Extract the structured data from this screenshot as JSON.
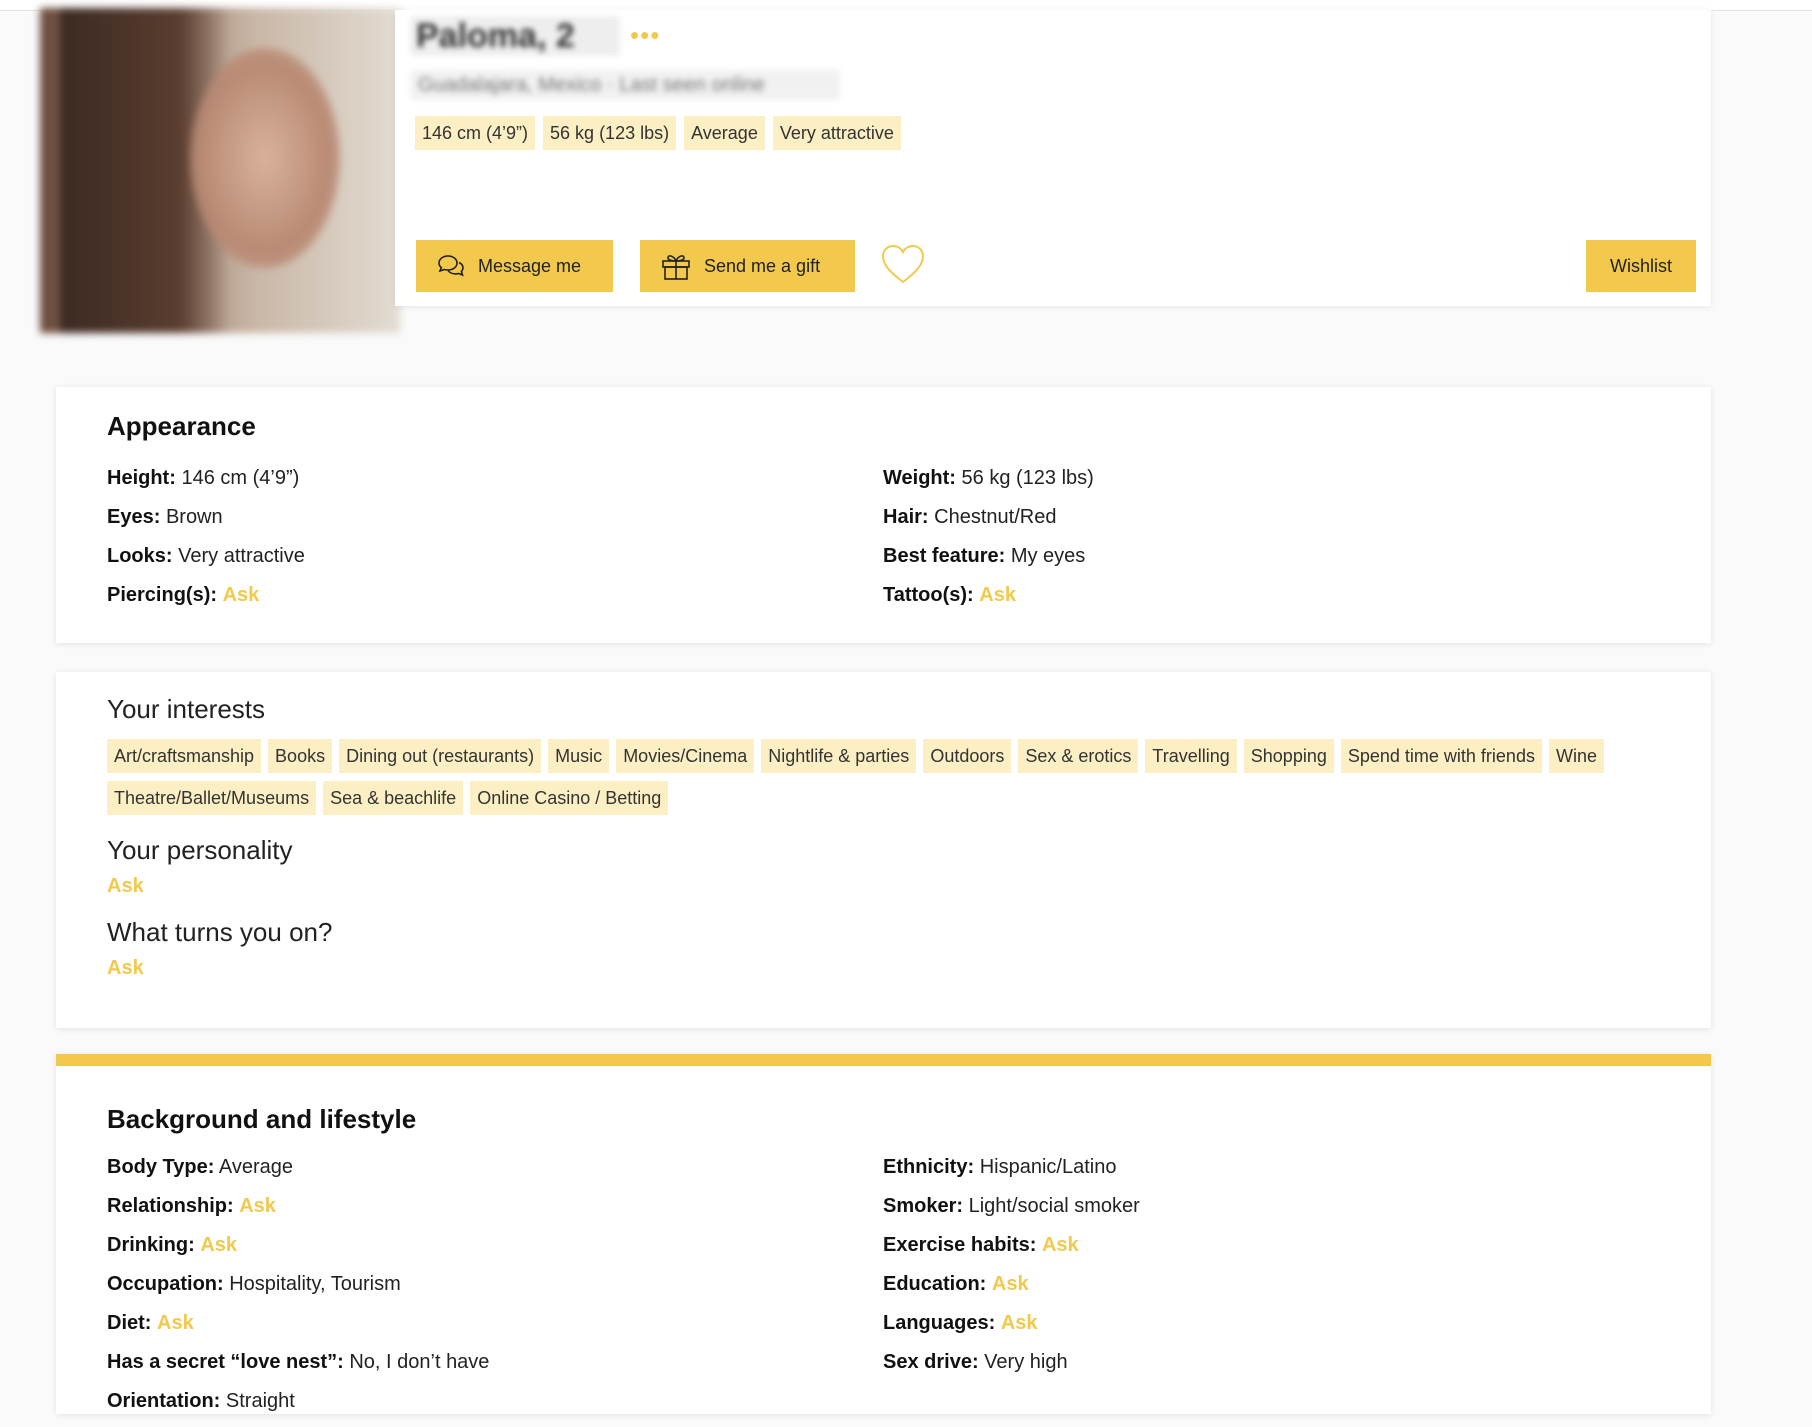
{
  "profile": {
    "name": "Paloma, 2",
    "subtitle": "Guadalajara, Mexico · Last seen online",
    "more_glyph": "•••",
    "chips": [
      "146 cm (4’9”)",
      "56 kg (123 lbs)",
      "Average",
      "Very attractive"
    ],
    "actions": {
      "message": "Message me",
      "gift": "Send me a gift",
      "wishlist": "Wishlist"
    }
  },
  "appearance": {
    "title": "Appearance",
    "rows": [
      {
        "label": "Height:",
        "value": "146 cm (4’9”)"
      },
      {
        "label": "Weight:",
        "value": "56 kg (123 lbs)"
      },
      {
        "label": "Eyes:",
        "value": "Brown"
      },
      {
        "label": "Hair:",
        "value": "Chestnut/Red"
      },
      {
        "label": "Looks:",
        "value": "Very attractive"
      },
      {
        "label": "Best feature:",
        "value": "My eyes"
      },
      {
        "label": "Piercing(s):",
        "value": "Ask",
        "ask": true
      },
      {
        "label": "Tattoo(s):",
        "value": "Ask",
        "ask": true
      }
    ]
  },
  "interests": {
    "title": "Your interests",
    "tags": [
      "Art/craftsmanship",
      "Books",
      "Dining out (restaurants)",
      "Music",
      "Movies/Cinema",
      "Nightlife & parties",
      "Outdoors",
      "Sex & erotics",
      "Travelling",
      "Shopping",
      "Spend time with friends",
      "Wine",
      "Theatre/Ballet/Museums",
      "Sea & beachlife",
      "Online Casino / Betting"
    ],
    "personality_title": "Your personality",
    "personality_value": "Ask",
    "turnon_title": "What turns you on?",
    "turnon_value": "Ask"
  },
  "background": {
    "title": "Background and lifestyle",
    "rows": [
      {
        "label": "Body Type:",
        "value": "Average"
      },
      {
        "label": "Ethnicity:",
        "value": "Hispanic/Latino"
      },
      {
        "label": "Relationship:",
        "value": "Ask",
        "ask": true
      },
      {
        "label": "Smoker:",
        "value": "Light/social smoker"
      },
      {
        "label": "Drinking:",
        "value": "Ask",
        "ask": true
      },
      {
        "label": "Exercise habits:",
        "value": "Ask",
        "ask": true
      },
      {
        "label": "Occupation:",
        "value": "Hospitality, Tourism"
      },
      {
        "label": "Education:",
        "value": "Ask",
        "ask": true
      },
      {
        "label": "Diet:",
        "value": "Ask",
        "ask": true
      },
      {
        "label": "Languages:",
        "value": "Ask",
        "ask": true
      },
      {
        "label": "Has a secret “love nest”:",
        "value": "No, I don’t have"
      },
      {
        "label": "Sex drive:",
        "value": "Very high"
      },
      {
        "label": "Orientation:",
        "value": "Straight"
      }
    ]
  },
  "colors": {
    "accent": "#f2c94c",
    "chip_bg": "#fcefc4"
  }
}
